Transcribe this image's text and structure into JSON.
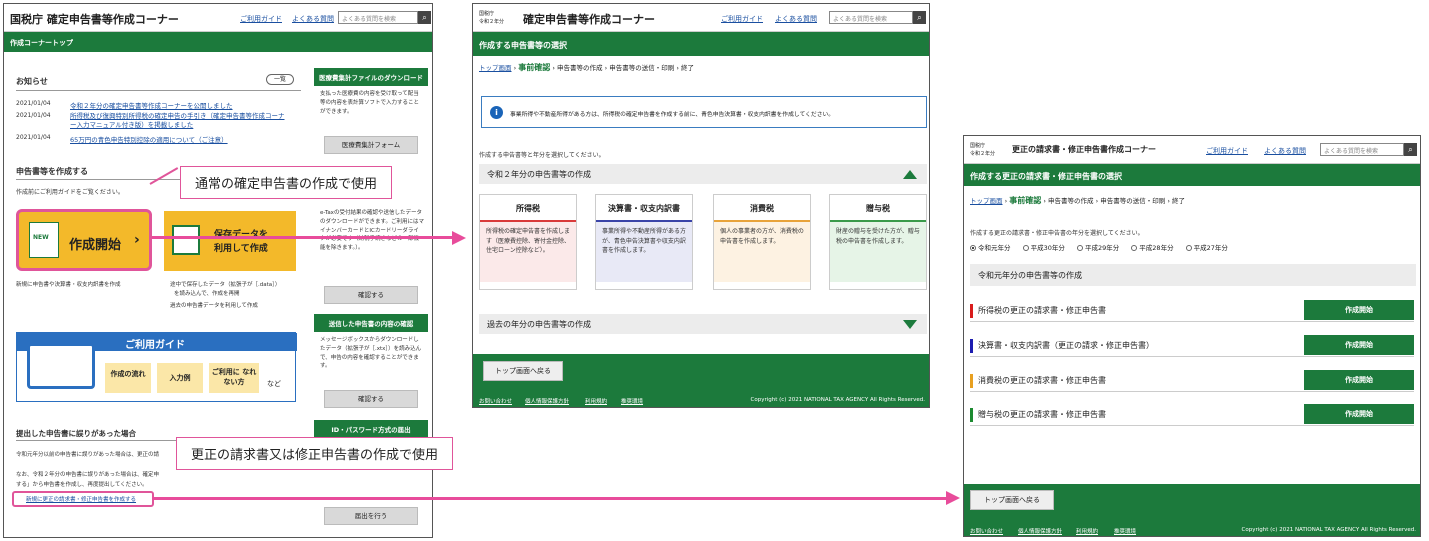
{
  "s1": {
    "logo": "国税庁 確定申告書等作成コーナー",
    "guide": "ご利用ガイド",
    "faq": "よくある質問",
    "search_ph": "よくある質問を検索",
    "bar": "作成コーナートップ",
    "news_title": "お知らせ",
    "news_btn": "一覧",
    "news": [
      {
        "date": "2021/01/04",
        "text": "令和２年分の確定申告書等作成コーナーを公開しました"
      },
      {
        "date": "2021/01/04",
        "text": "所得税及び復興特別所得税の確定申告の手引き（確定申告書等作成コーナー入力マニュアル付き版）を掲載しました"
      },
      {
        "date": "2021/01/04",
        "text": "65万円の青色申告特別控除の適用について（ご注意）"
      }
    ],
    "create_title": "申告書等を作成する",
    "create_sub": "作成前にご利用ガイドをご覧ください。",
    "start_badge": "NEW",
    "start_label": "作成開始",
    "saved_label1": "保存データを",
    "saved_label2": "利用して作成",
    "start_note": "新規に申告書や決算書・収支内訳書を作成",
    "saved_note1": "途中で保存したデータ（拡張子が［.data］）",
    "saved_note2": "を読み込んで、作成を再開",
    "saved_note3": "過去の申告書データを利用して作成",
    "guide_title": "ご利用ガイド",
    "guide_b1": "作成の流れ",
    "guide_b2": "入力例",
    "guide_b3": "ご利用に なれない方",
    "guide_etc": "など",
    "err_title": "提出した申告書に誤りがあった場合",
    "err_text1": "令和元年分以前の申告書に誤りがあった場合は、更正の請",
    "err_text2": "なお、令和２年分の申告書に誤りがあった場合は、確定申",
    "err_text3": "する」から申告書を作成し、再度提出してください。",
    "err_link": "新規に更正の請求書・修正申告書を作成する",
    "side1_head": "医療費集計ファイルのダウンロード",
    "side1_text": "支払った医療費の内容を受け取って配当等の内容を表計算ソフトで入力することができます。",
    "side1_btn": "医療費集計フォーム",
    "side2_text": "e-Taxの受付結果の確認や送信したデータのダウンロードができます。ご利用にはマイナンバーカードとICカードリーダライタが必要です（納税手続きなどの一部機能を除きます。）。",
    "side2_btn": "確認する",
    "side3_head": "送信した申告書の内容の確認",
    "side3_text": "メッセージボックスからダウンロードしたデータ（拡張子が［.xtx］）を読み込んで、申告の内容を確認することができます。",
    "side3_btn": "確認する",
    "side4_head": "ID・パスワード方式の届出",
    "side4_btn": "届出を行う"
  },
  "callout1": "通常の確定申告書の作成で使用",
  "callout2": "更正の請求書又は修正申告書の作成で使用",
  "s2": {
    "logo_small1": "国税庁",
    "logo_small2": "令和２年分",
    "logo": "確定申告書等作成コーナー",
    "guide": "ご利用ガイド",
    "faq": "よくある質問",
    "search_ph": "よくある質問を検索",
    "bar": "作成する申告書等の選択",
    "crumbs": [
      "トップ画面",
      "事前確認",
      "申告書等の作成",
      "申告書等の送信・印刷",
      "終了"
    ],
    "info": "事業所得や不動産所得がある方は、所得税の確定申告書を作成する前に、青色申告決算書・収支内訳書を作成してください。",
    "instr": "作成する申告書等と年分を選択してください。",
    "year_head": "令和２年分の申告書等の作成",
    "cards": [
      {
        "title": "所得税",
        "body": "所得税の確定申告書を作成します（医療費控除、寄付金控除、住宅ローン控除など）。",
        "color": "#d93a3a",
        "bg": "#fbe9e9"
      },
      {
        "title": "決算書・収支内訳書",
        "body": "事業所得や不動産所得がある方が、青色申告決算書や収支内訳書を作成します。",
        "color": "#3a44a8",
        "bg": "#e8e9f6"
      },
      {
        "title": "消費税",
        "body": "個人の事業者の方が、消費税の申告書を作成します。",
        "color": "#e8a33a",
        "bg": "#fdf2e2"
      },
      {
        "title": "贈与税",
        "body": "財産の贈与を受けた方が、贈与税の申告書を作成します。",
        "color": "#3a9a4a",
        "bg": "#e6f4e7"
      }
    ],
    "past_head": "過去の年分の申告書等の作成",
    "back": "トップ画面へ戻る",
    "foot": [
      "お問い合わせ",
      "個人情報保護方針",
      "利用規約",
      "推奨環境"
    ],
    "copyright": "Copyright (c) 2021 NATIONAL TAX AGENCY All Rights Reserved."
  },
  "s3": {
    "logo_small1": "国税庁",
    "logo_small2": "令和２年分",
    "logo": "更正の請求書・修正申告書作成コーナー",
    "guide": "ご利用ガイド",
    "faq": "よくある質問",
    "search_ph": "よくある質問を検索",
    "bar": "作成する更正の請求書・修正申告書の選択",
    "crumbs": [
      "トップ画面",
      "事前確認",
      "申告書等の作成",
      "申告書等の送信・印刷",
      "終了"
    ],
    "instr": "作成する更正の請求書・修正申告書の年分を選択してください。",
    "years": [
      "令和元年分",
      "平成30年分",
      "平成29年分",
      "平成28年分",
      "平成27年分"
    ],
    "year_head": "令和元年分の申告書等の作成",
    "rows": [
      {
        "label": "所得税の更正の請求書・修正申告書",
        "color": "#d91c1c",
        "btn": "作成開始"
      },
      {
        "label": "決算書・収支内訳書（更正の請求・修正申告書）",
        "color": "#1c1cb0",
        "btn": "作成開始"
      },
      {
        "label": "消費税の更正の請求書・修正申告書",
        "color": "#e8a020",
        "btn": "作成開始"
      },
      {
        "label": "贈与税の更正の請求書・修正申告書",
        "color": "#1c8a30",
        "btn": "作成開始"
      }
    ],
    "back": "トップ画面へ戻る",
    "foot": [
      "お問い合わせ",
      "個人情報保護方針",
      "利用規約",
      "推奨環境"
    ],
    "copyright": "Copyright (c) 2021 NATIONAL TAX AGENCY All Rights Reserved."
  }
}
